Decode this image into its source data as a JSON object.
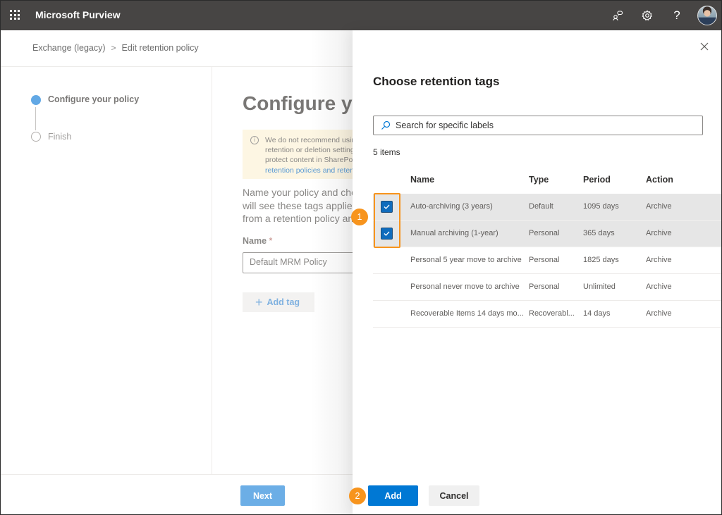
{
  "topbar": {
    "app_title": "Microsoft Purview",
    "icons": [
      "app-launcher-icon",
      "community-icon",
      "settings-icon",
      "help-icon",
      "user-avatar"
    ],
    "help_glyph": "?"
  },
  "breadcrumb": {
    "items": [
      "Exchange (legacy)",
      "Edit retention policy"
    ],
    "separator": ">"
  },
  "wizard": {
    "steps": [
      {
        "label": "Configure your policy",
        "state": "current"
      },
      {
        "label": "Finish",
        "state": "upcoming"
      }
    ]
  },
  "main": {
    "title": "Configure your policy",
    "warning": {
      "lines": [
        "We do not recommend using",
        "retention or deletion settings",
        "protect content in SharePoint",
        "retention policies and retention"
      ]
    },
    "description_lines": [
      "Name your policy and choose",
      "will see these tags applied",
      "from a retention policy and"
    ],
    "name_label": "Name",
    "required_marker": "*",
    "name_value": "Default MRM Policy",
    "add_tag_label": "Add tag",
    "next_label": "Next"
  },
  "panel": {
    "title": "Choose retention tags",
    "search_placeholder": "Search for specific labels",
    "items_count": "5 items",
    "columns": [
      "Name",
      "Type",
      "Period",
      "Action"
    ],
    "rows": [
      {
        "name": "Auto-archiving (3 years)",
        "type": "Default",
        "period": "1095 days",
        "action": "Archive",
        "selected": true
      },
      {
        "name": "Manual archiving (1-year)",
        "type": "Personal",
        "period": "365 days",
        "action": "Archive",
        "selected": true
      },
      {
        "name": "Personal 5 year move to archive",
        "type": "Personal",
        "period": "1825 days",
        "action": "Archive",
        "selected": false
      },
      {
        "name": "Personal never move to archive",
        "type": "Personal",
        "period": "Unlimited",
        "action": "Archive",
        "selected": false
      },
      {
        "name": "Recoverable Items 14 days mo...",
        "type": "Recoverabl...",
        "period": "14 days",
        "action": "Archive",
        "selected": false
      }
    ],
    "add_label": "Add",
    "cancel_label": "Cancel"
  },
  "callouts": [
    {
      "number": "1",
      "target": "selected-checkboxes"
    },
    {
      "number": "2",
      "target": "add-button"
    }
  ],
  "colors": {
    "topbar": "#474544",
    "primary": "#0078d4",
    "callout": "#f7941d",
    "selected_row": "#e6e6e6"
  }
}
